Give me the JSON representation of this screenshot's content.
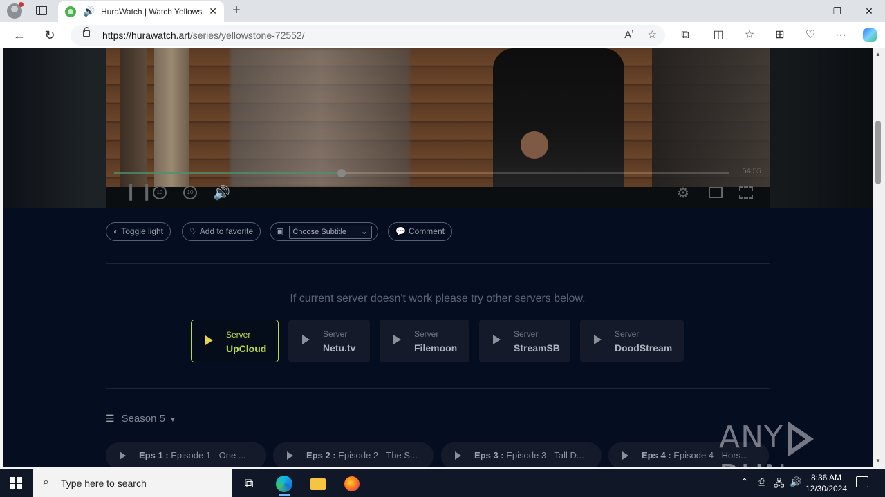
{
  "browser": {
    "tab_title": "HuraWatch | Watch Yellowstone",
    "tab_close": "✕",
    "new_tab": "+",
    "url_host": "https://hurawatch.art",
    "url_path": "/series/yellowstone-72552/",
    "window_controls": {
      "minimize": "—",
      "maximize": "❐",
      "close": "✕"
    }
  },
  "player": {
    "duration": "54:55",
    "progress_fraction": 0.37,
    "rewind_label": "10",
    "forward_label": "10"
  },
  "actions": {
    "toggle_light": "Toggle light",
    "add_favorite": "Add to favorite",
    "subtitle_select": "Choose Subtitle",
    "comment": "Comment"
  },
  "servers": {
    "notice": "If current server doesn't work please try other servers below.",
    "label": "Server",
    "items": [
      {
        "name": "UpCloud",
        "active": true
      },
      {
        "name": "Netu.tv",
        "active": false
      },
      {
        "name": "Filemoon",
        "active": false
      },
      {
        "name": "StreamSB",
        "active": false
      },
      {
        "name": "DoodStream",
        "active": false
      }
    ]
  },
  "season": {
    "label": "Season 5"
  },
  "episodes": [
    {
      "num": "Eps 1 :",
      "title": "Episode 1 - One ..."
    },
    {
      "num": "Eps 2 :",
      "title": "Episode 2 - The S..."
    },
    {
      "num": "Eps 3 :",
      "title": "Episode 3 - Tall D..."
    },
    {
      "num": "Eps 4 :",
      "title": "Episode 4 - Hors..."
    }
  ],
  "watermark": {
    "left": "ANY",
    "right": "RUN"
  },
  "taskbar": {
    "search_placeholder": "Type here to search",
    "time": "8:36 AM",
    "date": "12/30/2024"
  },
  "colors": {
    "page_bg": "#050d20",
    "active_server": "#b9d84a",
    "play_icon_active": "#e8d44a"
  }
}
